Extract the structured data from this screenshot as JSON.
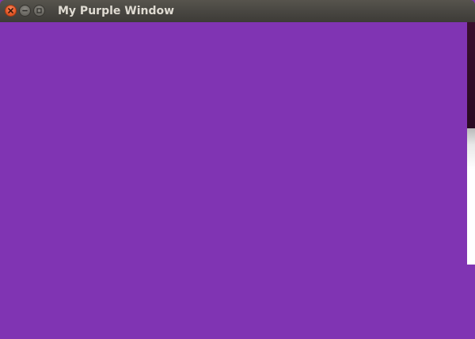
{
  "window": {
    "title": "My Purple Window",
    "background_color": "#8034b3"
  },
  "titlebar": {
    "buttons": [
      {
        "name": "close",
        "icon": "close-icon",
        "color": "#e85b2b"
      },
      {
        "name": "minimize",
        "icon": "minimize-icon",
        "color": "#6f6d67"
      },
      {
        "name": "maximize",
        "icon": "maximize-icon",
        "color": "#6f6d67"
      }
    ]
  },
  "desktop_strip": {
    "top_color": "#2a0a22",
    "bottom_color": "#ffffff"
  }
}
